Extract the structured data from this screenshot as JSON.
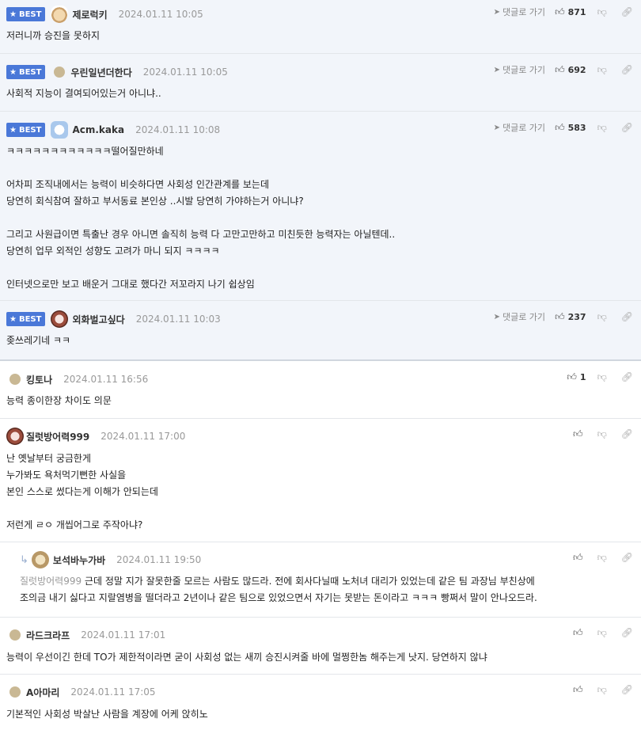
{
  "labels": {
    "best": "BEST",
    "goto_reply": "댓글로 가기"
  },
  "comments": [
    {
      "nick": "제로럭키",
      "date": "2024.01.11 10:05",
      "likes": "871",
      "body": "저러니까 승진을 못하지"
    },
    {
      "nick": "우린일년더한다",
      "date": "2024.01.11 10:05",
      "likes": "692",
      "body": "사회적 지능이 결여되어있는거 아니냐.."
    },
    {
      "nick": "Acm.kaka",
      "date": "2024.01.11 10:08",
      "likes": "583",
      "body": "ㅋㅋㅋㅋㅋㅋㅋㅋㅋㅋㅋㅋ떨어질만하네\n\n어차피 조직내에서는 능력이 비슷하다면 사회성 인간관계를 보는데\n당연히 회식참여 잘하고 부서동료 본인상 ..시발 당연히 가야하는거 아니냐?\n\n그리고 사원급이면 특출난 경우 아니면 솔직히 능력 다 고만고만하고 미친듯한 능력자는 아닐텐데..\n당연히 업무 외적인 성향도 고려가 마니 되지 ㅋㅋㅋㅋ\n\n인터넷으로만 보고 배운거 그대로 했다간 저꼬라지 나기 쉽상임"
    },
    {
      "nick": "외화벌고싶다",
      "date": "2024.01.11 10:03",
      "likes": "237",
      "body": "좆쓰레기네 ㅋㅋ"
    },
    {
      "nick": "킹토나",
      "date": "2024.01.11 16:56",
      "likes": "1",
      "body": "능력 종이한장 차이도 의문"
    },
    {
      "nick": "질럿방어력999",
      "date": "2024.01.11 17:00",
      "likes": "",
      "body": "난 옛날부터 궁금한게\n누가봐도 욕처먹기뻔한 사실을\n본인 스스로 썼다는게 이해가 안되는데\n\n저런게 ㄹㅇ 개씹어그로 주작아냐?"
    },
    {
      "nick": "보석바누가바",
      "date": "2024.01.11 19:50",
      "likes": "",
      "mention": "질럿방어력999",
      "body": " 근데 정말 지가 잘못한줄 모르는 사람도 많드라. 전에 회사다닐때 노처녀 대리가 있었는데 같은 팀 과장님 부친상에\n조의금 내기 싫다고 지랄염병을 떨더라고 2년이나 같은 팀으로 있었으면서 자기는 못받는 돈이라고 ㅋㅋㅋ 빵쩌서 말이 안나오드라."
    },
    {
      "nick": "라드크라프",
      "date": "2024.01.11 17:01",
      "likes": "",
      "body": "능력이 우선이긴 한데 TO가 제한적이라면 굳이 사회성 없는 새끼 승진시켜줄 바에 멀쩡한놈 해주는게 낫지. 당연하지 않냐"
    },
    {
      "nick": "A아마리",
      "date": "2024.01.11 17:05",
      "likes": "",
      "body": "기본적인 사회성 박살난 사람을 계장에 어케 앉히노"
    }
  ]
}
